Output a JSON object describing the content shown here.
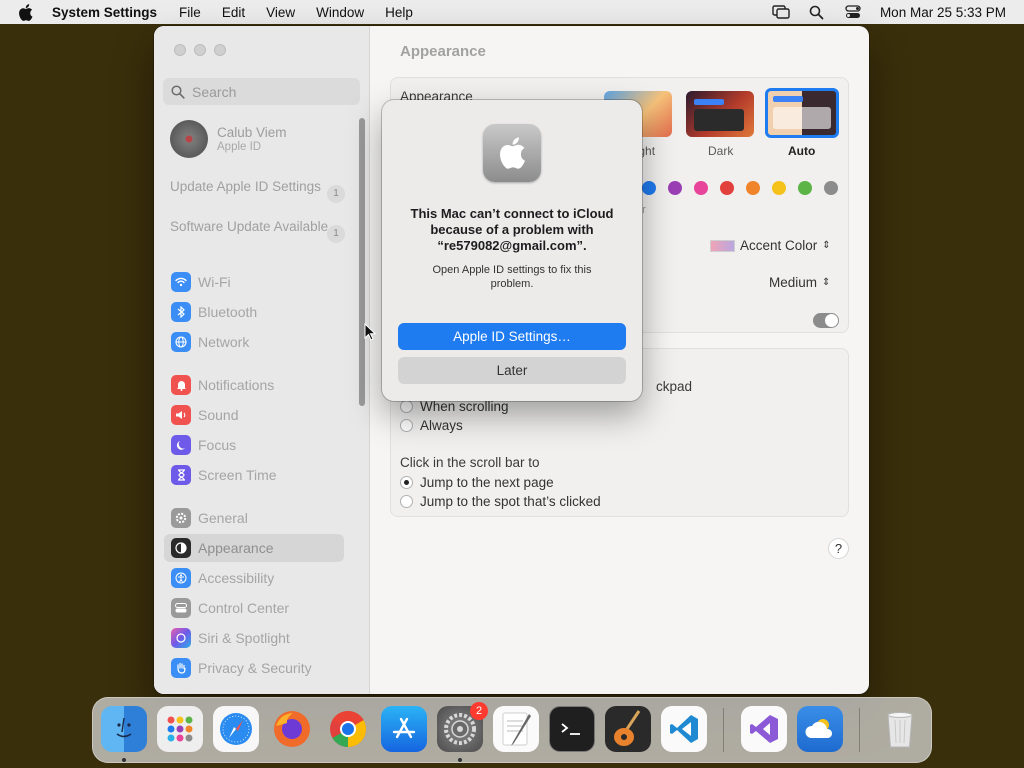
{
  "menubar": {
    "app_name": "System Settings",
    "items": [
      "File",
      "Edit",
      "View",
      "Window",
      "Help"
    ],
    "clock": "Mon Mar 25  5:33 PM"
  },
  "sidebar": {
    "search_placeholder": "Search",
    "account": {
      "name": "Calub Viem",
      "subtitle": "Apple ID"
    },
    "notices": [
      {
        "label": "Update Apple ID Settings",
        "count": "1"
      },
      {
        "label": "Software Update Available",
        "count": "1"
      }
    ],
    "items": [
      {
        "label": "Wi-Fi",
        "color": "#3b8ef5"
      },
      {
        "label": "Bluetooth",
        "color": "#3b8ef5"
      },
      {
        "label": "Network",
        "color": "#3b8ef5"
      },
      {
        "label": "Notifications",
        "color": "#f0524f"
      },
      {
        "label": "Sound",
        "color": "#f0524f"
      },
      {
        "label": "Focus",
        "color": "#6e5ae8"
      },
      {
        "label": "Screen Time",
        "color": "#6e5ae8"
      },
      {
        "label": "General",
        "color": "#9a9a9a"
      },
      {
        "label": "Appearance",
        "color": "#2a2a2a"
      },
      {
        "label": "Accessibility",
        "color": "#3b8ef5"
      },
      {
        "label": "Control Center",
        "color": "#9a9a9a"
      },
      {
        "label": "Siri & Spotlight",
        "color": "#c05fd6"
      },
      {
        "label": "Privacy & Security",
        "color": "#3b8ef5"
      }
    ]
  },
  "main": {
    "title": "Appearance",
    "appearance_label": "Appearance",
    "themes": [
      {
        "label": "Light"
      },
      {
        "label": "Dark"
      },
      {
        "label": "Auto"
      }
    ],
    "accent_fragment": "or",
    "accent_colors": [
      "#1f7bf0",
      "#9b3fb5",
      "#e8449a",
      "#e2403c",
      "#f0842a",
      "#f5c21b",
      "#5bb445",
      "#8c8c8c"
    ],
    "highlight_value": "Accent Color",
    "sidebar_icon_size_value": "Medium",
    "scrollbars_fragment": "ckpad",
    "scroll_options": [
      "When scrolling",
      "Always"
    ],
    "click_label": "Click in the scroll bar to",
    "click_options": [
      "Jump to the next page",
      "Jump to the spot that’s clicked"
    ],
    "help": "?"
  },
  "alert": {
    "title": "This Mac can’t connect to iCloud because of a problem with “re579082@gmail.com”.",
    "message": "Open Apple ID settings to fix this problem.",
    "primary_button": "Apple ID Settings…",
    "secondary_button": "Later"
  },
  "dock": {
    "apps": [
      "Finder",
      "Launchpad",
      "Safari",
      "Firefox",
      "Chrome",
      "App Store",
      "System Settings",
      "TextEdit",
      "Terminal",
      "GarageBand",
      "Visual Studio Code",
      "Visual Studio",
      "Weather",
      "Trash"
    ],
    "settings_badge": "2"
  }
}
